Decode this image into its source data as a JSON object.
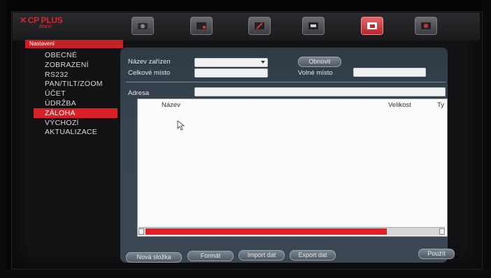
{
  "brand": {
    "name": "CP PLUS",
    "tagline": "Brand"
  },
  "breadcrumb": "Nastavení",
  "toolbar": [
    {
      "icon": "camera-icon",
      "active": false
    },
    {
      "icon": "video-icon",
      "active": false
    },
    {
      "icon": "tools-icon",
      "active": false
    },
    {
      "icon": "disk-icon",
      "active": false
    },
    {
      "icon": "backup-icon",
      "active": true
    },
    {
      "icon": "info-icon",
      "active": false
    }
  ],
  "sidebar": {
    "items": [
      {
        "label": "OBECNÉ"
      },
      {
        "label": "ZOBRAZENÍ"
      },
      {
        "label": "RS232"
      },
      {
        "label": "PAN/TILT/ZOOM"
      },
      {
        "label": "ÚČET"
      },
      {
        "label": "ÚDRŽBA"
      },
      {
        "label": "ZÁLOHA",
        "active": true
      },
      {
        "label": "VÝCHOZÍ"
      },
      {
        "label": "AKTUALIZACE"
      }
    ]
  },
  "form": {
    "device_name_label": "Název zařízen",
    "device_name_value": "",
    "refresh_button": "Obnovit",
    "total_space_label": "Celkové místo",
    "total_space_value": "",
    "free_space_label": "Volné místo",
    "free_space_value": "",
    "address_label": "Adresa",
    "address_value": ""
  },
  "file_list": {
    "columns": [
      "Název",
      "Velikost",
      "Ty"
    ],
    "rows": [],
    "scroll_position": 0.95
  },
  "actions": {
    "new_folder": "Nová složka",
    "format": "Formát",
    "import": "Import dat",
    "export": "Export dat",
    "apply": "Použít"
  }
}
